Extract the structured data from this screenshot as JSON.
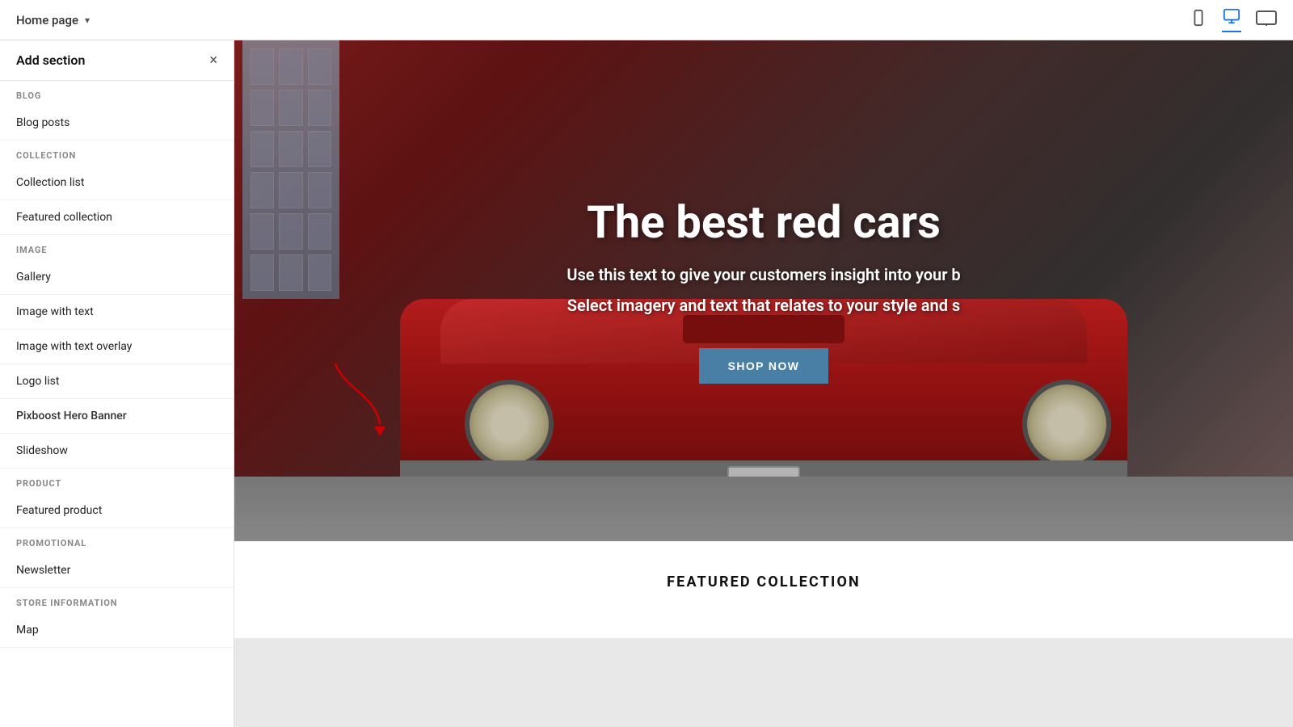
{
  "header": {
    "title": "Home page",
    "chevron": "▾"
  },
  "sidebar": {
    "title": "Add section",
    "close_icon": "×",
    "sections": [
      {
        "label": "BLOG",
        "items": [
          "Blog posts"
        ]
      },
      {
        "label": "COLLECTION",
        "items": [
          "Collection list",
          "Featured collection"
        ]
      },
      {
        "label": "IMAGE",
        "items": [
          "Gallery",
          "Image with text",
          "Image with text overlay",
          "Logo list",
          "Pixboost Hero Banner",
          "Slideshow"
        ]
      },
      {
        "label": "PRODUCT",
        "items": [
          "Featured product"
        ]
      },
      {
        "label": "PROMOTIONAL",
        "items": [
          "Newsletter"
        ]
      },
      {
        "label": "STORE INFORMATION",
        "items": [
          "Map"
        ]
      }
    ]
  },
  "hero": {
    "title": "The best red cars",
    "subtitle_line1": "Use this text to give your customers insight into your b",
    "subtitle_line2": "Select imagery and text that relates to your style and s",
    "button_label": "SHOP NOW"
  },
  "featured": {
    "title": "FEATURED COLLECTION"
  },
  "icons": {
    "mobile": "📱",
    "desktop": "🖥",
    "widescreen": "⬜"
  }
}
